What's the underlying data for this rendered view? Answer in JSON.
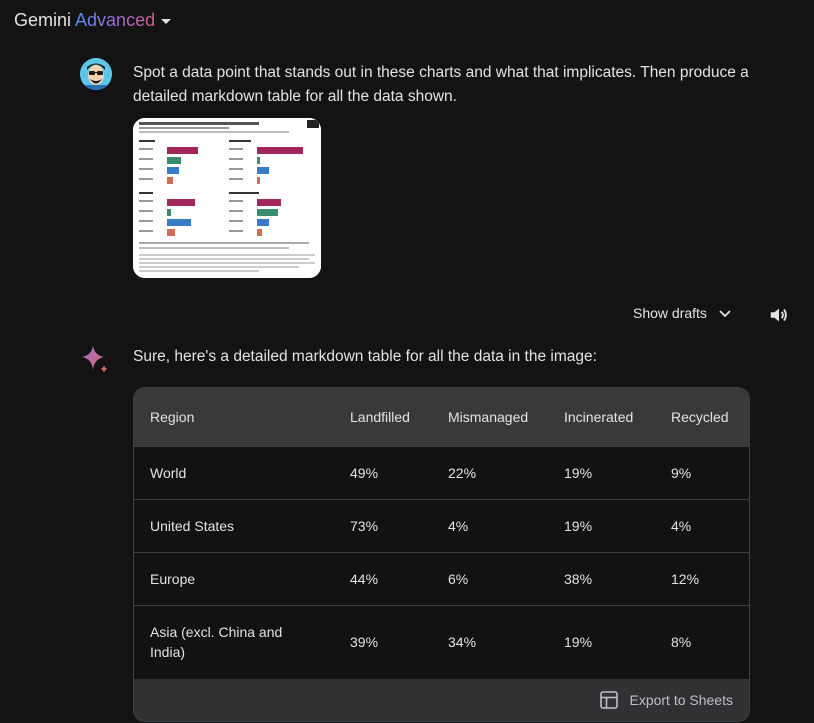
{
  "header": {
    "brand_main": "Gemini",
    "brand_advanced": "Advanced"
  },
  "prompt": {
    "text": "Spot a data point that stands out in these charts and what that implicates. Then produce a detailed markdown table for all the data shown."
  },
  "drafts": {
    "label": "Show drafts"
  },
  "response": {
    "intro": "Sure, here's a detailed markdown table for all the data in the image:",
    "table": {
      "headers": [
        "Region",
        "Landfilled",
        "Mismanaged",
        "Incinerated",
        "Recycled"
      ],
      "rows": [
        [
          "World",
          "49%",
          "22%",
          "19%",
          "9%"
        ],
        [
          "United States",
          "73%",
          "4%",
          "19%",
          "4%"
        ],
        [
          "Europe",
          "44%",
          "6%",
          "38%",
          "12%"
        ],
        [
          "Asia (excl. China and India)",
          "39%",
          "34%",
          "19%",
          "8%"
        ]
      ]
    },
    "export_label": "Export to Sheets"
  },
  "colors": {
    "background": "#131314",
    "accent_blue": "#4f8ef7",
    "accent_pink": "#d65c86"
  },
  "icons": [
    "user-avatar",
    "chevron-down-icon",
    "speaker-icon",
    "gemini-sparkle-icon",
    "sheets-icon"
  ]
}
